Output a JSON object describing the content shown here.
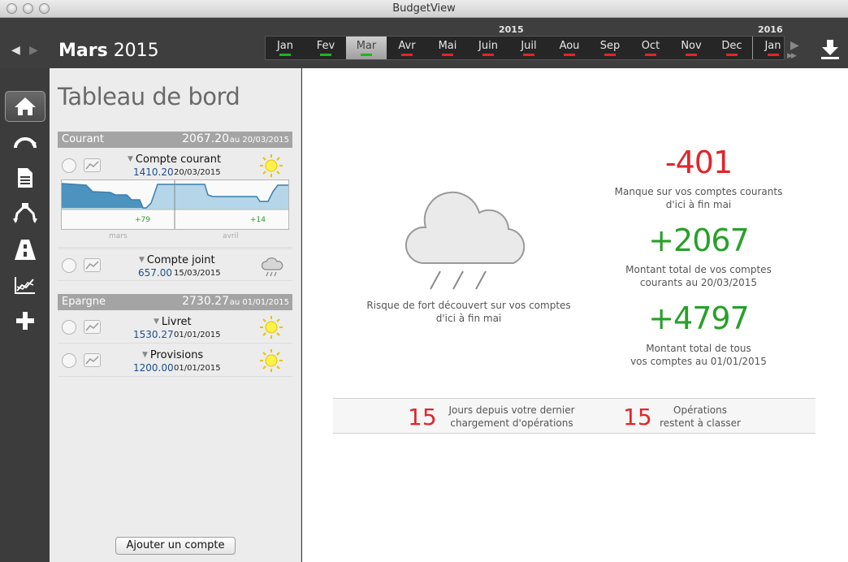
{
  "window": {
    "title": "BudgetView"
  },
  "header": {
    "month_name": "Mars",
    "year": "2015",
    "timeline_years": [
      "2015",
      "2016"
    ],
    "months": [
      {
        "label": "Jan",
        "status": "green"
      },
      {
        "label": "Fev",
        "status": "green"
      },
      {
        "label": "Mar",
        "status": "green",
        "selected": true
      },
      {
        "label": "Avr",
        "status": "red"
      },
      {
        "label": "Mai",
        "status": "red"
      },
      {
        "label": "Juin",
        "status": "red"
      },
      {
        "label": "Juil",
        "status": "red"
      },
      {
        "label": "Aou",
        "status": "red"
      },
      {
        "label": "Sep",
        "status": "red"
      },
      {
        "label": "Oct",
        "status": "red"
      },
      {
        "label": "Nov",
        "status": "red"
      },
      {
        "label": "Dec",
        "status": "red"
      },
      {
        "label": "Jan",
        "status": "red"
      }
    ],
    "colors": {
      "green": "#1fb51f",
      "red": "#e0262b"
    }
  },
  "sidebar": {
    "icons": [
      "home-icon",
      "gauge-icon",
      "document-icon",
      "split-icon",
      "road-icon",
      "chart-icon",
      "plus-icon"
    ]
  },
  "panel": {
    "title": "Tableau de bord",
    "groups": [
      {
        "name": "Courant",
        "amount": "2067.20",
        "date": "au 20/03/2015",
        "accounts": [
          {
            "name": "Compte courant",
            "amount": "1410.20",
            "date": "20/03/2015",
            "weather": "sun"
          },
          {
            "name": "Compte joint",
            "amount": "657.00",
            "date": "15/03/2015",
            "weather": "rain"
          }
        ]
      },
      {
        "name": "Epargne",
        "amount": "2730.27",
        "date": "au 01/01/2015",
        "accounts": [
          {
            "name": "Livret",
            "amount": "1530.27",
            "date": "01/01/2015",
            "weather": "sun"
          },
          {
            "name": "Provisions",
            "amount": "1200.00",
            "date": "01/01/2015",
            "weather": "sun"
          }
        ]
      }
    ],
    "chart": {
      "label_left": "+79",
      "label_right": "+14",
      "month_left": "mars",
      "month_right": "avril"
    },
    "add_button": "Ajouter un compte"
  },
  "main": {
    "risk_text_1": "Risque de fort découvert sur vos comptes",
    "risk_text_2": "d'ici à fin mai",
    "stats": [
      {
        "value": "-401",
        "line1": "Manque sur vos comptes courants",
        "line2": "d'ici à fin mai",
        "color": "red"
      },
      {
        "value": "+2067",
        "line1": "Montant total de vos comptes",
        "line2": "courants au 20/03/2015",
        "color": "green"
      },
      {
        "value": "+4797",
        "line1": "Montant total de tous",
        "line2": "vos comptes au 01/01/2015",
        "color": "green"
      }
    ],
    "strip": {
      "days_value": "15",
      "days_line1": "Jours depuis votre dernier",
      "days_line2": "chargement d'opérations",
      "ops_value": "15",
      "ops_line1": "Opérations",
      "ops_line2": "restent à classer"
    }
  }
}
